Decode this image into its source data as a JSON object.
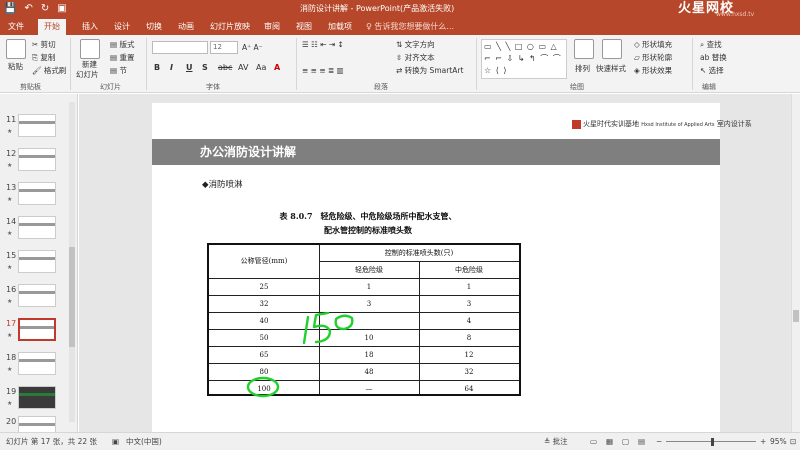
{
  "titlebar": {
    "title": "消防设计讲解 - PowerPoint(产品激活失败)",
    "logo": "火星网校",
    "logo_url": "www.hxsd.tv",
    "qa_save": "💾",
    "qa_undo": "↶",
    "qa_redo": "↻",
    "qa_present": "▣"
  },
  "tabs": [
    "文件",
    "开始",
    "插入",
    "设计",
    "切换",
    "动画",
    "幻灯片放映",
    "审阅",
    "视图",
    "加载项"
  ],
  "tell_me": "♀ 告诉我您想要做什么...",
  "ribbon": {
    "clipboard": {
      "label": "剪贴板",
      "paste": "粘贴",
      "cut": "剪切",
      "copy": "复制",
      "format_painter": "格式刷"
    },
    "slides": {
      "label": "幻灯片",
      "new": "新建",
      "new2": "幻灯片",
      "layout": "版式",
      "reset": "重置",
      "section": "节"
    },
    "font": {
      "label": "字体",
      "size": "12",
      "bold": "B",
      "italic": "I",
      "underline": "U",
      "shadow": "S",
      "strike": "abc",
      "spacing": "AV",
      "case": "Aa",
      "color": "A"
    },
    "paragraph": {
      "label": "段落",
      "text_direction": "文字方向",
      "align_text": "对齐文本",
      "smartart": "转换为 SmartArt"
    },
    "drawing": {
      "label": "绘图",
      "shapes": "▭ ╲ ╲ □ ○ ▭ △ ⌐ ⌐ ⇩ ↳ ↰ ⌒ ⌒ ☆ ⟨ ⟩",
      "arrange": "排列",
      "quick_styles": "快速样式",
      "fill": "形状填充",
      "outline": "形状轮廓",
      "effects": "形状效果"
    },
    "editing": {
      "label": "编辑",
      "find": "查找",
      "replace": "替换",
      "select": "选择"
    }
  },
  "thumbnails": [
    {
      "num": "11"
    },
    {
      "num": "12"
    },
    {
      "num": "13"
    },
    {
      "num": "14"
    },
    {
      "num": "15"
    },
    {
      "num": "16"
    },
    {
      "num": "17"
    },
    {
      "num": "18"
    },
    {
      "num": "19"
    },
    {
      "num": "20"
    }
  ],
  "slide": {
    "brand_cn": "火星时代实训基地",
    "brand_en": "Hxsd Institute of Applied Arts",
    "brand_dept": "室内设计系",
    "title": "办公消防设计讲解",
    "bullet": "◆消防喷淋",
    "table_caption_1": "表 8.0.7　轻危险级、中危险级场所中配水支管、",
    "table_caption_2": "配水管控制的标准喷头数",
    "table": {
      "col0_header": "公称管径(mm)",
      "group_header": "控制的标准喷头数(只)",
      "col1_header": "轻危险级",
      "col2_header": "中危险级",
      "rows": [
        [
          "25",
          "1",
          "1"
        ],
        [
          "32",
          "3",
          "3"
        ],
        [
          "40",
          "",
          "4"
        ],
        [
          "50",
          "10",
          "8"
        ],
        [
          "65",
          "18",
          "12"
        ],
        [
          "80",
          "48",
          "32"
        ],
        [
          "100",
          "—",
          "64"
        ]
      ]
    },
    "annotation_text": "150"
  },
  "status": {
    "slide_info": "幻灯片 第 17 张，共 22 张",
    "language": "中文(中国)",
    "notes": "≜ 批注",
    "zoom_minus": "−",
    "zoom_plus": "+",
    "zoom": "95%"
  },
  "colors": {
    "accent": "#b7472a",
    "banner": "#7f7f7f",
    "annotation": "#1fd12a"
  }
}
